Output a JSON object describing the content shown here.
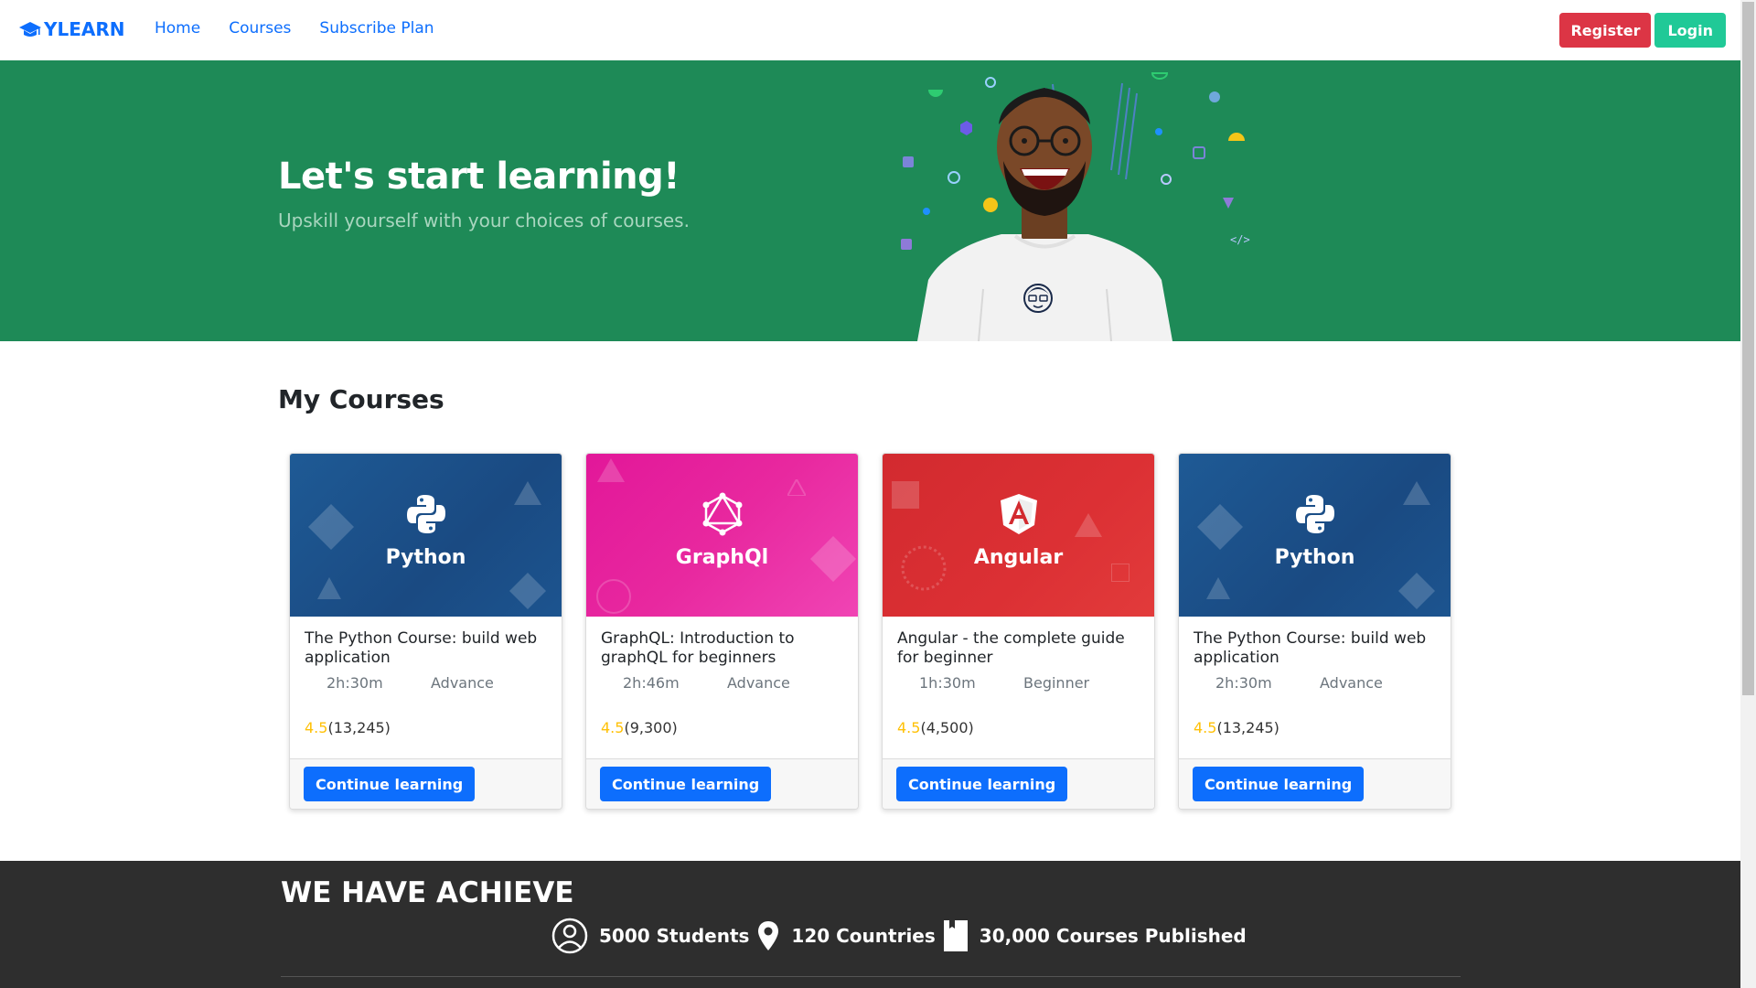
{
  "brand": {
    "name": "YLEARN",
    "icon": "graduation-cap-icon",
    "color": "#0d6efd"
  },
  "nav": {
    "links": [
      {
        "label": "Home"
      },
      {
        "label": "Courses"
      },
      {
        "label": "Subscribe Plan"
      }
    ],
    "register_label": "Register",
    "login_label": "Login"
  },
  "hero": {
    "title": "Let's start learning!",
    "subtitle": "Upskill yourself with your choices of courses.",
    "background": "#1e8a57"
  },
  "my_courses": {
    "heading": "My Courses",
    "cards": [
      {
        "image_title": "Python",
        "theme": "python",
        "icon": "python-logo-icon",
        "title": "The Python Course: build web application",
        "duration": "2h:30m",
        "level": "Advance",
        "rating": "4.5",
        "reviews": "(13,245)",
        "button": "Continue learning"
      },
      {
        "image_title": "GraphQl",
        "theme": "graphql",
        "icon": "graphql-logo-icon",
        "title": "GraphQL: Introduction to graphQL for beginners",
        "duration": "2h:46m",
        "level": "Advance",
        "rating": "4.5",
        "reviews": "(9,300)",
        "button": "Continue learning"
      },
      {
        "image_title": "Angular",
        "theme": "angular",
        "icon": "angular-logo-icon",
        "title": "Angular - the complete guide for beginner",
        "duration": "1h:30m",
        "level": "Beginner",
        "rating": "4.5",
        "reviews": "(4,500)",
        "button": "Continue learning"
      },
      {
        "image_title": "Python",
        "theme": "python",
        "icon": "python-logo-icon",
        "title": "The Python Course: build web application",
        "duration": "2h:30m",
        "level": "Advance",
        "rating": "4.5",
        "reviews": "(13,245)",
        "button": "Continue learning"
      }
    ]
  },
  "achieve": {
    "title": "WE HAVE ACHIEVE",
    "stats": [
      {
        "icon": "user-circle-icon",
        "label": "5000 Students"
      },
      {
        "icon": "map-pin-icon",
        "label": "120 Countries"
      },
      {
        "icon": "book-icon",
        "label": "30,000 Courses Published"
      }
    ]
  },
  "colors": {
    "primary": "#0d6efd",
    "danger": "#dc3545",
    "success": "#20c997",
    "rating": "#ffc107",
    "dark": "#2e2e2e"
  }
}
